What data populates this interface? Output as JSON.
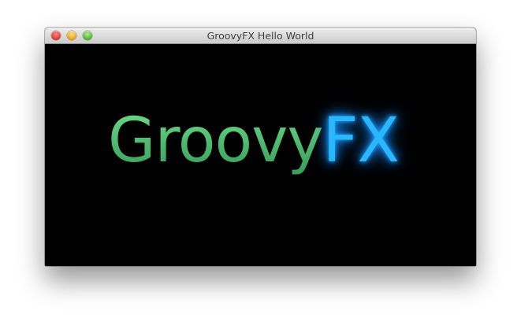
{
  "window": {
    "title": "GroovyFX Hello World"
  },
  "content": {
    "brand_part1": "Groovy",
    "brand_part2": "FX"
  },
  "colors": {
    "background": "#000000",
    "groovy_green": "#4fc073",
    "fx_blue": "#29b8ff"
  },
  "icons": {
    "close": "close-icon",
    "minimize": "minimize-icon",
    "zoom": "zoom-icon"
  }
}
